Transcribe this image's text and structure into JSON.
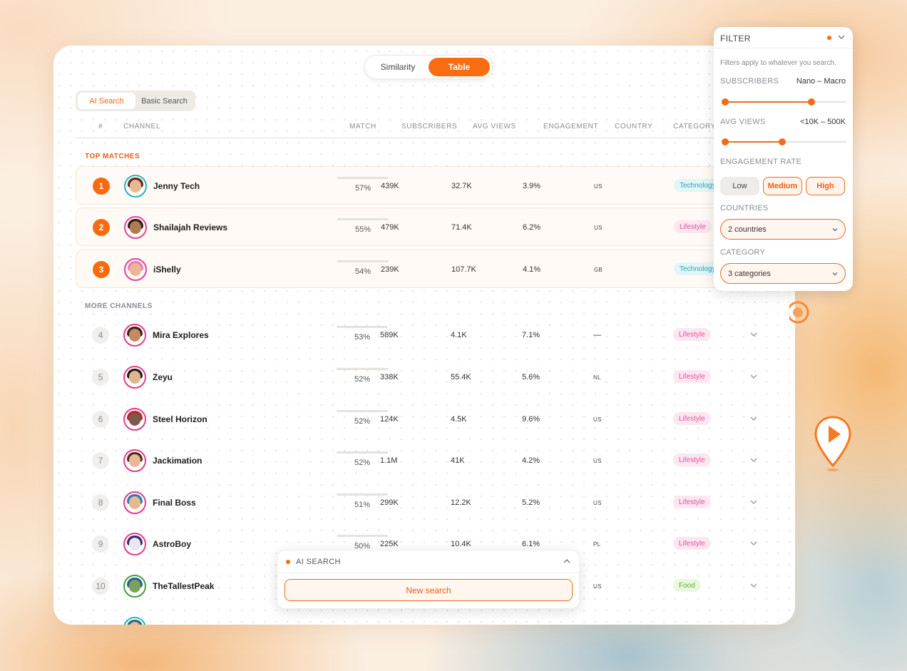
{
  "view_toggle": {
    "options": [
      "Similarity",
      "Table"
    ],
    "active": "Table"
  },
  "search_toggle": {
    "options": [
      "AI Search",
      "Basic Search"
    ],
    "active": "AI Search"
  },
  "table": {
    "headers": {
      "rank": "#",
      "channel": "CHANNEL",
      "match": "MATCH",
      "subscribers": "SUBSCRIBERS",
      "avg_views": "AVG VIEWS",
      "engagement": "ENGAGEMENT",
      "country": "COUNTRY",
      "category": "CATEGORY"
    },
    "top_label": "TOP MATCHES",
    "more_label": "MORE CHANNELS",
    "top_rows": [
      {
        "rank": "1",
        "name": "Jenny Tech",
        "match": "57%",
        "subscribers": "439K",
        "avg_views": "32.7K",
        "engagement": "3.9%",
        "country": "US",
        "category": "Technology"
      },
      {
        "rank": "2",
        "name": "Shailajah Reviews",
        "match": "55%",
        "subscribers": "479K",
        "avg_views": "71.4K",
        "engagement": "6.2%",
        "country": "US",
        "category": "Lifestyle"
      },
      {
        "rank": "3",
        "name": "iShelly",
        "match": "54%",
        "subscribers": "239K",
        "avg_views": "107.7K",
        "engagement": "4.1%",
        "country": "GB",
        "category": "Technology"
      }
    ],
    "more_rows": [
      {
        "rank": "4",
        "name": "Mira Explores",
        "match": "53%",
        "subscribers": "589K",
        "avg_views": "4.1K",
        "engagement": "7.1%",
        "country": "—",
        "category": "Lifestyle"
      },
      {
        "rank": "5",
        "name": "Zeyu",
        "match": "52%",
        "subscribers": "338K",
        "avg_views": "55.4K",
        "engagement": "5.6%",
        "country": "NL",
        "category": "Lifestyle"
      },
      {
        "rank": "6",
        "name": "Steel Horizon",
        "match": "52%",
        "subscribers": "124K",
        "avg_views": "4.5K",
        "engagement": "9.6%",
        "country": "US",
        "category": "Lifestyle"
      },
      {
        "rank": "7",
        "name": "Jackimation",
        "match": "52%",
        "subscribers": "1.1M",
        "avg_views": "41K",
        "engagement": "4.2%",
        "country": "US",
        "category": "Lifestyle"
      },
      {
        "rank": "8",
        "name": "Final Boss",
        "match": "51%",
        "subscribers": "299K",
        "avg_views": "12.2K",
        "engagement": "5.2%",
        "country": "US",
        "category": "Lifestyle"
      },
      {
        "rank": "9",
        "name": "AstroBoy",
        "match": "50%",
        "subscribers": "225K",
        "avg_views": "10.4K",
        "engagement": "6.1%",
        "country": "PL",
        "category": "Lifestyle"
      },
      {
        "rank": "10",
        "name": "TheTallestPeak",
        "match": "",
        "subscribers": "",
        "avg_views": "",
        "engagement": "",
        "country": "US",
        "category": "Food"
      }
    ]
  },
  "ai_panel": {
    "title": "AI SEARCH",
    "button": "New search"
  },
  "filter": {
    "title": "FILTER",
    "note": "Filters apply to whatever you search.",
    "subscribers": {
      "label": "SUBSCRIBERS",
      "value": "Nano – Macro",
      "range": [
        0.0,
        0.71
      ]
    },
    "avg_views": {
      "label": "AVG VIEWS",
      "value": "<10K – 500K",
      "range": [
        0.0,
        0.47
      ]
    },
    "engagement": {
      "label": "ENGAGEMENT RATE",
      "options": [
        "Low",
        "Medium",
        "High"
      ],
      "selected": [
        "Medium",
        "High"
      ]
    },
    "countries": {
      "label": "COUNTRIES",
      "value": "2 countries"
    },
    "category": {
      "label": "CATEGORY",
      "value": "3 categories"
    }
  },
  "colors": {
    "accent": "#fb6b10",
    "tech": "#2aa6b8",
    "lifestyle": "#e0529a",
    "food": "#64ad2f"
  }
}
